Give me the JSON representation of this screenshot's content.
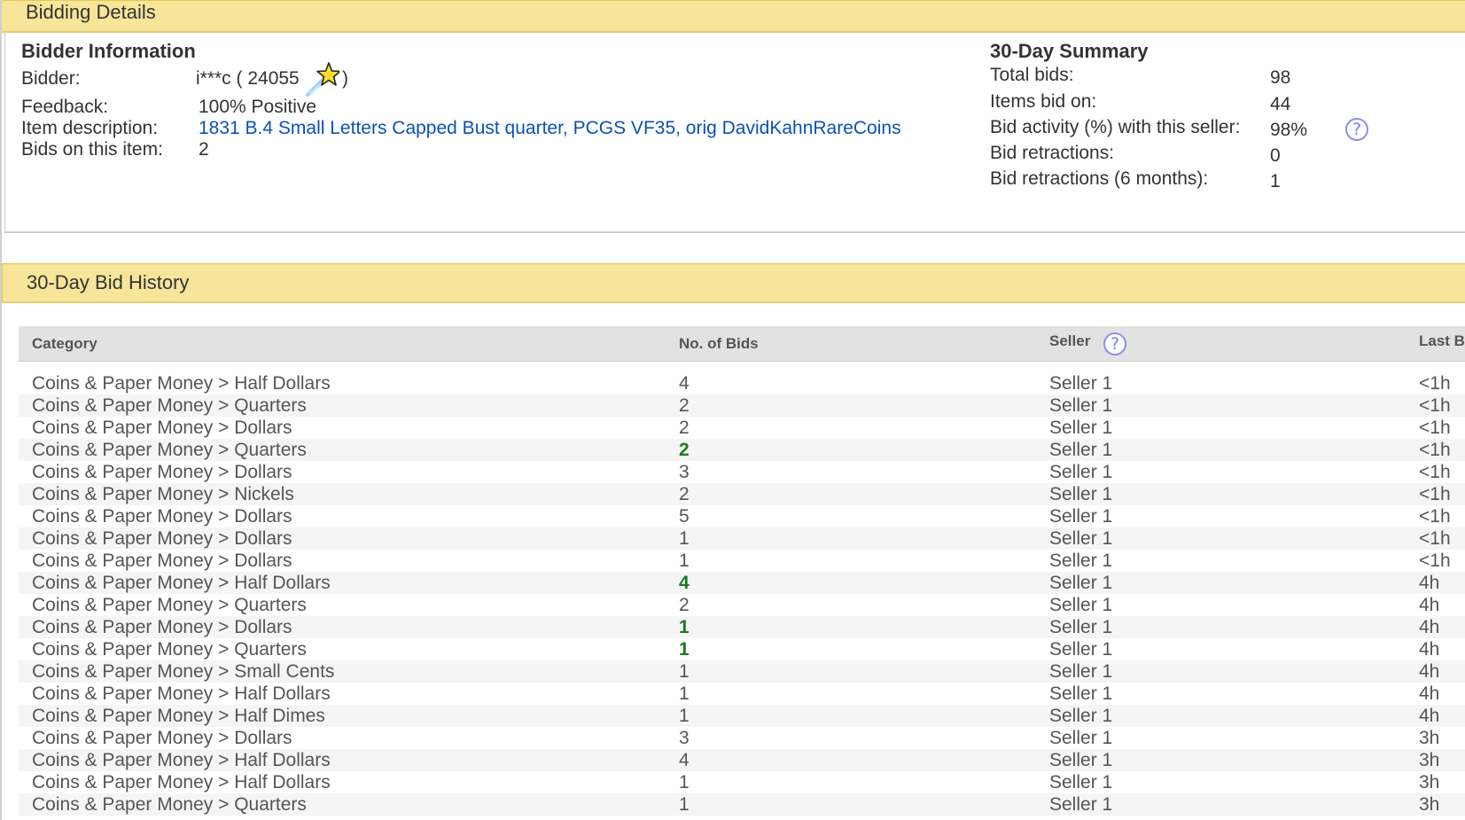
{
  "sections": {
    "bidding_details": "Bidding Details",
    "bid_history": "30-Day Bid History"
  },
  "bidder_info": {
    "title": "Bidder Information",
    "bidder_label": "Bidder:",
    "bidder_value": "i***c ( 24055",
    "bidder_close": ")",
    "feedback_label": "Feedback:",
    "feedback_value": "100% Positive",
    "item_label": "Item description:",
    "item_value": "1831 B.4 Small Letters Capped Bust quarter, PCGS VF35, orig DavidKahnRareCoins",
    "bids_label": "Bids on this item:",
    "bids_value": "2"
  },
  "summary": {
    "title": "30-Day Summary",
    "rows": [
      {
        "label": "Total bids:",
        "value": "98"
      },
      {
        "label": "Items bid on:",
        "value": "44"
      },
      {
        "label": "Bid activity (%) with this seller:",
        "value": "98%"
      },
      {
        "label": "Bid retractions:",
        "value": "0"
      },
      {
        "label": "Bid retractions (6 months):",
        "value": "1"
      }
    ]
  },
  "icons": {
    "star": "star-icon",
    "help": "help-icon",
    "help_glyph": "?"
  },
  "colors": {
    "header_bg": "#f7e59a",
    "link": "#0b51b7",
    "highlight_bids": "#1b7a1b"
  },
  "table": {
    "headers": {
      "category": "Category",
      "bids": "No. of Bids",
      "seller": "Seller",
      "last": "Last B"
    },
    "rows": [
      {
        "category": "Coins & Paper Money > Half Dollars",
        "bids": "4",
        "highlight": false,
        "seller": "Seller 1",
        "last": "<1h"
      },
      {
        "category": "Coins & Paper Money > Quarters",
        "bids": "2",
        "highlight": false,
        "seller": "Seller 1",
        "last": "<1h"
      },
      {
        "category": "Coins & Paper Money > Dollars",
        "bids": "2",
        "highlight": false,
        "seller": "Seller 1",
        "last": "<1h"
      },
      {
        "category": "Coins & Paper Money > Quarters",
        "bids": "2",
        "highlight": true,
        "seller": "Seller 1",
        "last": "<1h"
      },
      {
        "category": "Coins & Paper Money > Dollars",
        "bids": "3",
        "highlight": false,
        "seller": "Seller 1",
        "last": "<1h"
      },
      {
        "category": "Coins & Paper Money > Nickels",
        "bids": "2",
        "highlight": false,
        "seller": "Seller 1",
        "last": "<1h"
      },
      {
        "category": "Coins & Paper Money > Dollars",
        "bids": "5",
        "highlight": false,
        "seller": "Seller 1",
        "last": "<1h"
      },
      {
        "category": "Coins & Paper Money > Dollars",
        "bids": "1",
        "highlight": false,
        "seller": "Seller 1",
        "last": "<1h"
      },
      {
        "category": "Coins & Paper Money > Dollars",
        "bids": "1",
        "highlight": false,
        "seller": "Seller 1",
        "last": "<1h"
      },
      {
        "category": "Coins & Paper Money > Half Dollars",
        "bids": "4",
        "highlight": true,
        "seller": "Seller 1",
        "last": "4h"
      },
      {
        "category": "Coins & Paper Money > Quarters",
        "bids": "2",
        "highlight": false,
        "seller": "Seller 1",
        "last": "4h"
      },
      {
        "category": "Coins & Paper Money > Dollars",
        "bids": "1",
        "highlight": true,
        "seller": "Seller 1",
        "last": "4h"
      },
      {
        "category": "Coins & Paper Money > Quarters",
        "bids": "1",
        "highlight": true,
        "seller": "Seller 1",
        "last": "4h"
      },
      {
        "category": "Coins & Paper Money > Small Cents",
        "bids": "1",
        "highlight": false,
        "seller": "Seller 1",
        "last": "4h"
      },
      {
        "category": "Coins & Paper Money > Half Dollars",
        "bids": "1",
        "highlight": false,
        "seller": "Seller 1",
        "last": "4h"
      },
      {
        "category": "Coins & Paper Money > Half Dimes",
        "bids": "1",
        "highlight": false,
        "seller": "Seller 1",
        "last": "4h"
      },
      {
        "category": "Coins & Paper Money > Dollars",
        "bids": "3",
        "highlight": false,
        "seller": "Seller 1",
        "last": "3h"
      },
      {
        "category": "Coins & Paper Money > Half Dollars",
        "bids": "4",
        "highlight": false,
        "seller": "Seller 1",
        "last": "3h"
      },
      {
        "category": "Coins & Paper Money > Half Dollars",
        "bids": "1",
        "highlight": false,
        "seller": "Seller 1",
        "last": "3h"
      },
      {
        "category": "Coins & Paper Money > Quarters",
        "bids": "1",
        "highlight": false,
        "seller": "Seller 1",
        "last": "3h"
      }
    ]
  }
}
